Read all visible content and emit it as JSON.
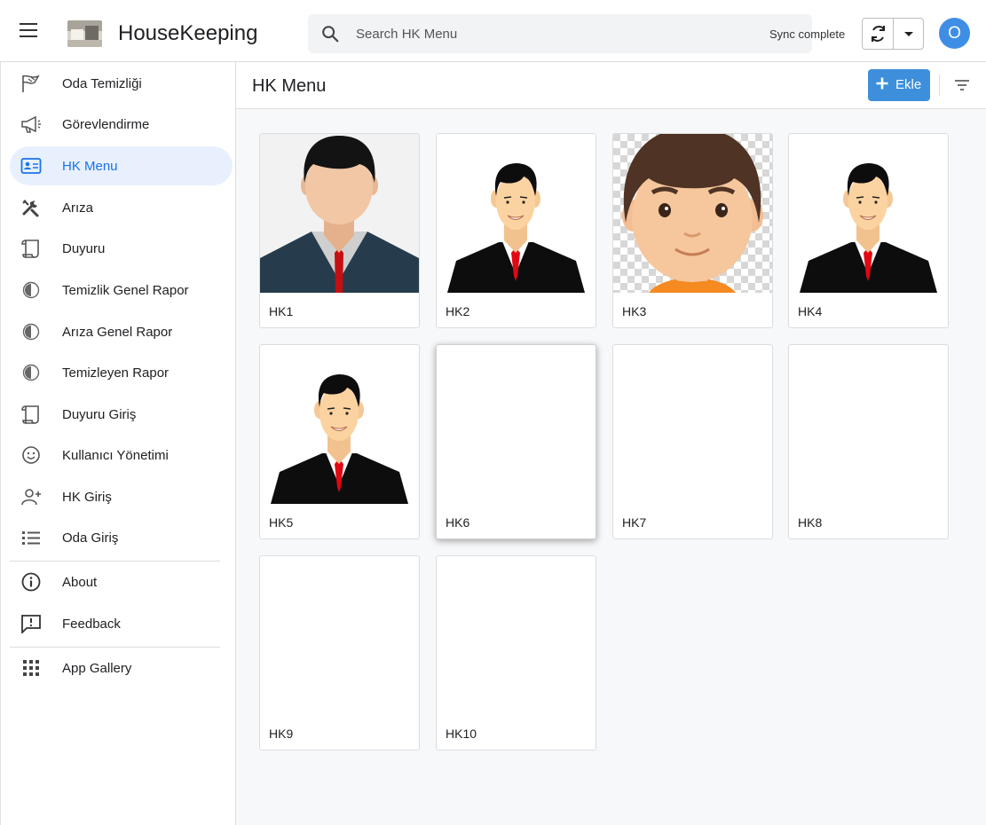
{
  "header": {
    "app_title": "HouseKeeping",
    "search_placeholder": "Search HK Menu",
    "sync_status": "Sync complete",
    "avatar_initial": "O",
    "avatar_color": "#3f8ee6"
  },
  "sidebar": {
    "items": [
      {
        "label": "Oda Temizliği",
        "icon": "flag-icon"
      },
      {
        "label": "Görevlendirme",
        "icon": "megaphone-icon"
      },
      {
        "label": "HK Menu",
        "icon": "contact-card-icon",
        "active": true
      },
      {
        "label": "Arıza",
        "icon": "tools-icon"
      },
      {
        "label": "Duyuru",
        "icon": "scroll-icon"
      },
      {
        "label": "Temizlik Genel Rapor",
        "icon": "report-circle-icon"
      },
      {
        "label": "Arıza Genel Rapor",
        "icon": "report-circle-icon"
      },
      {
        "label": "Temizleyen Rapor",
        "icon": "report-circle-icon"
      },
      {
        "label": "Duyuru Giriş",
        "icon": "scroll-icon"
      },
      {
        "label": "Kullanıcı Yönetimi",
        "icon": "smiley-icon"
      },
      {
        "label": "HK Giriş",
        "icon": "add-person-icon"
      },
      {
        "label": "Oda Giriş",
        "icon": "list-icon"
      },
      {
        "label": "About",
        "icon": "info-icon"
      },
      {
        "label": "Feedback",
        "icon": "feedback-icon"
      },
      {
        "label": "App Gallery",
        "icon": "grid-icon"
      }
    ]
  },
  "main": {
    "title": "HK Menu",
    "add_label": "Ekle",
    "accent_color": "#3d8fdc",
    "cards": [
      {
        "label": "HK1",
        "image": "man-suit-photo"
      },
      {
        "label": "HK2",
        "image": "man-suit-cartoon"
      },
      {
        "label": "HK3",
        "image": "boy-cartoon"
      },
      {
        "label": "HK4",
        "image": "man-suit-cartoon"
      },
      {
        "label": "HK5",
        "image": "man-suit-cartoon"
      },
      {
        "label": "HK6",
        "image": "none"
      },
      {
        "label": "HK7",
        "image": "none"
      },
      {
        "label": "HK8",
        "image": "none"
      },
      {
        "label": "HK9",
        "image": "none"
      },
      {
        "label": "HK10",
        "image": "none"
      }
    ]
  }
}
